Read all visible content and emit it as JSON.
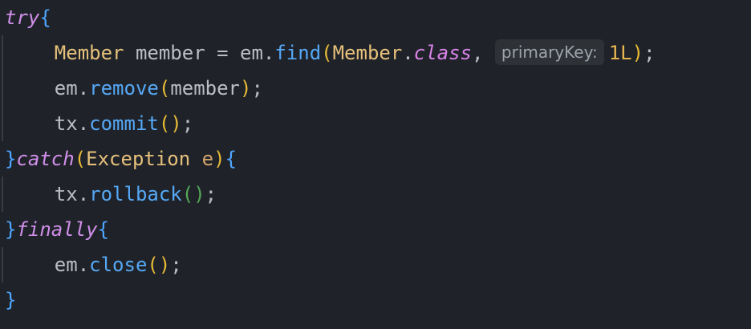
{
  "code": {
    "line1": {
      "kw": "try",
      "brace": "{"
    },
    "line2": {
      "indent": "    ",
      "type": "Member",
      "var": " member = em.",
      "method": "find",
      "open": "(",
      "type2": "Member",
      "dot": ".",
      "cls": "class",
      "comma": ", ",
      "hint": "primaryKey:",
      "num": "1L",
      "close": ")",
      "end": ";"
    },
    "line3": {
      "indent": "    ",
      "obj": "em.",
      "method": "remove",
      "open": "(",
      "arg": "member",
      "close": ")",
      "end": ";"
    },
    "line4": {
      "indent": "    ",
      "obj": "tx.",
      "method": "commit",
      "parens": "()",
      "end": ";"
    },
    "line5": {
      "brace1": "}",
      "kw": "catch",
      "open": "(",
      "type": "Exception",
      "sp": " ",
      "param": "e",
      "close": ")",
      "brace2": "{"
    },
    "line6": {
      "indent": "    ",
      "obj": "tx.",
      "method": "rollback",
      "parens": "()",
      "end": ";"
    },
    "line7": {
      "brace1": "}",
      "kw": "finally",
      "brace2": "{"
    },
    "line8": {
      "indent": "    ",
      "obj": "em.",
      "method": "close",
      "parens": "()",
      "end": ";"
    },
    "line9": {
      "brace": "}"
    }
  },
  "colors": {
    "background": "#1f2329",
    "keyword": "#cf8ee8",
    "brace": "#4fa6ff",
    "method": "#56a8f5",
    "type": "#e6c07b",
    "paren_yellow": "#e8ba36",
    "paren_green": "#54a857",
    "hint_bg": "#2e3237"
  }
}
